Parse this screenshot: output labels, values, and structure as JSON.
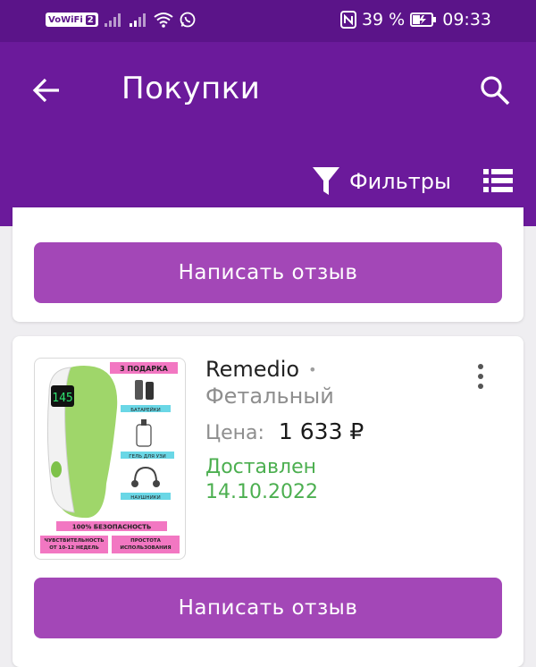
{
  "status_bar": {
    "vowifi": "VoWiFi",
    "sim": "2",
    "battery_percent": "39 %",
    "time": "09:33"
  },
  "toolbar": {
    "title": "Покупки",
    "filter_label": "Фильтры"
  },
  "purchases": [
    {
      "review_label": "Написать отзыв"
    },
    {
      "brand": "Remedio",
      "name": "Фетальный",
      "price_label": "Цена:",
      "price": "1 633 ₽",
      "status_line1": "Доставлен",
      "status_line2": "14.10.2022",
      "review_label": "Написать отзыв",
      "image": {
        "banner": "3 ПОДАРКА",
        "screen_value": "145",
        "gift1": "БАТАРЕЙКИ",
        "gift2": "ГЕЛЬ ДЛЯ УЗИ",
        "gift3": "НАУШНИКИ",
        "safety": "100% БЕЗОПАСНОСТЬ",
        "feature1": "ЧУВСТВИТЕЛЬНОСТЬ ОТ 10-12 НЕДЕЛЬ",
        "feature2": "ПРОСТОТА ИСПОЛЬЗОВАНИЯ"
      }
    }
  ],
  "colors": {
    "status_bar": "#5b1489",
    "toolbar": "#6b1a9b",
    "button": "#a347b7",
    "delivered": "#4caf50"
  }
}
